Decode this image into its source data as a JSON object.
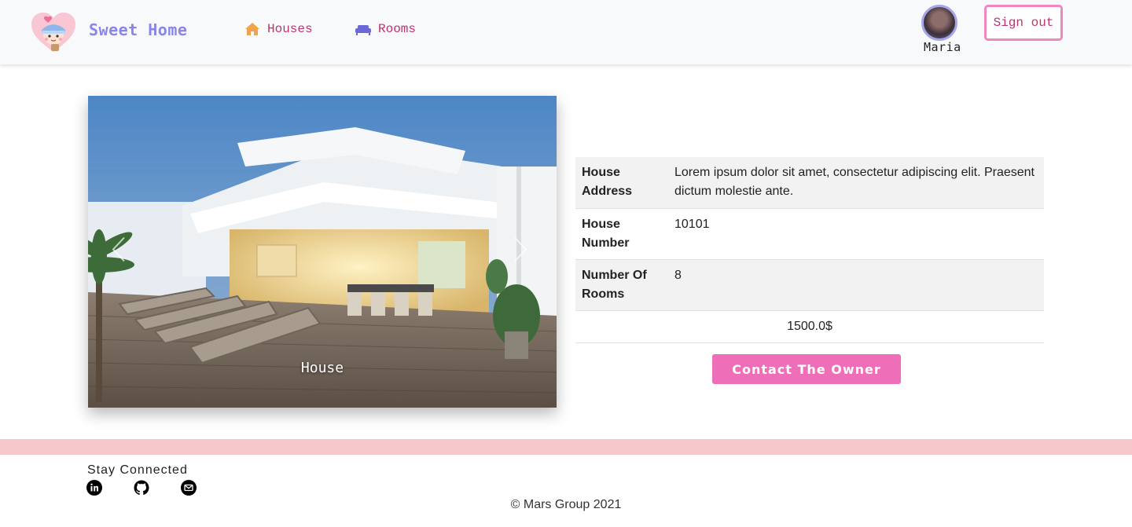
{
  "navbar": {
    "brand": "Sweet Home",
    "links": [
      {
        "label": "Houses",
        "icon": "home-icon",
        "color": "#c0316f",
        "icon_color": "#f2a24a"
      },
      {
        "label": "Rooms",
        "icon": "sofa-icon",
        "color": "#c0316f",
        "icon_color": "#6c68d8"
      }
    ],
    "user": {
      "name": "Maria"
    },
    "signout_label": "Sign out"
  },
  "carousel": {
    "caption": "House",
    "prev_icon": "chevron-left-icon",
    "next_icon": "chevron-right-icon"
  },
  "details": {
    "rows": [
      {
        "key": "House Address",
        "value": "Lorem ipsum dolor sit amet, consectetur adipiscing elit. Praesent dictum molestie ante."
      },
      {
        "key": "House Number",
        "value": "10101"
      },
      {
        "key": "Number Of Rooms",
        "value": "8"
      }
    ],
    "price": "1500.0$",
    "contact_label": "Contact The Owner"
  },
  "footer": {
    "stay_connected": "Stay Connected",
    "social_icons": [
      "linkedin-icon",
      "github-icon",
      "email-icon"
    ],
    "copyright": "© Mars Group 2021"
  },
  "colors": {
    "accent_pink": "#ee6fb8",
    "link_color": "#c0316f",
    "brand_color": "#8a86e6",
    "footer_band": "#f6c8cc"
  }
}
